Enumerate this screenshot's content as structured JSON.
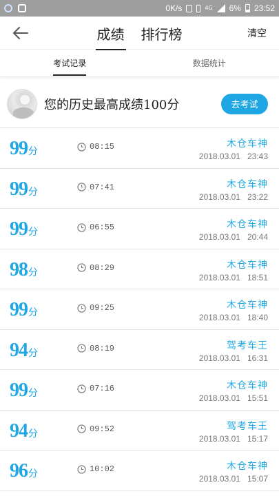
{
  "statusbar": {
    "network_speed": "0K/s",
    "network_type": "4G",
    "battery_percent": "6%",
    "time": "23:52"
  },
  "header": {
    "tab_scores": "成绩",
    "tab_ranking": "排行榜",
    "clear_label": "清空"
  },
  "subtabs": {
    "records": "考试记录",
    "statistics": "数据统计"
  },
  "best": {
    "text": "您的历史最高成绩100分",
    "button_label": "去考试"
  },
  "records": [
    {
      "score": "99",
      "unit": "分",
      "duration": "08:15",
      "rank": "木仓车神",
      "date": "2018.03.01",
      "time": "23:43"
    },
    {
      "score": "99",
      "unit": "分",
      "duration": "07:41",
      "rank": "木仓车神",
      "date": "2018.03.01",
      "time": "23:22"
    },
    {
      "score": "99",
      "unit": "分",
      "duration": "06:55",
      "rank": "木仓车神",
      "date": "2018.03.01",
      "time": "20:44"
    },
    {
      "score": "98",
      "unit": "分",
      "duration": "08:29",
      "rank": "木仓车神",
      "date": "2018.03.01",
      "time": "18:51"
    },
    {
      "score": "99",
      "unit": "分",
      "duration": "09:25",
      "rank": "木仓车神",
      "date": "2018.03.01",
      "time": "18:40"
    },
    {
      "score": "94",
      "unit": "分",
      "duration": "08:19",
      "rank": "驾考车王",
      "date": "2018.03.01",
      "time": "16:31"
    },
    {
      "score": "99",
      "unit": "分",
      "duration": "07:16",
      "rank": "木仓车神",
      "date": "2018.03.01",
      "time": "15:51"
    },
    {
      "score": "94",
      "unit": "分",
      "duration": "09:52",
      "rank": "驾考车王",
      "date": "2018.03.01",
      "time": "15:17"
    },
    {
      "score": "96",
      "unit": "分",
      "duration": "10:02",
      "rank": "木仓车神",
      "date": "2018.03.01",
      "time": "15:07"
    }
  ],
  "colors": {
    "accent": "#1ea7e3",
    "statusbar": "#9e9e9e"
  }
}
